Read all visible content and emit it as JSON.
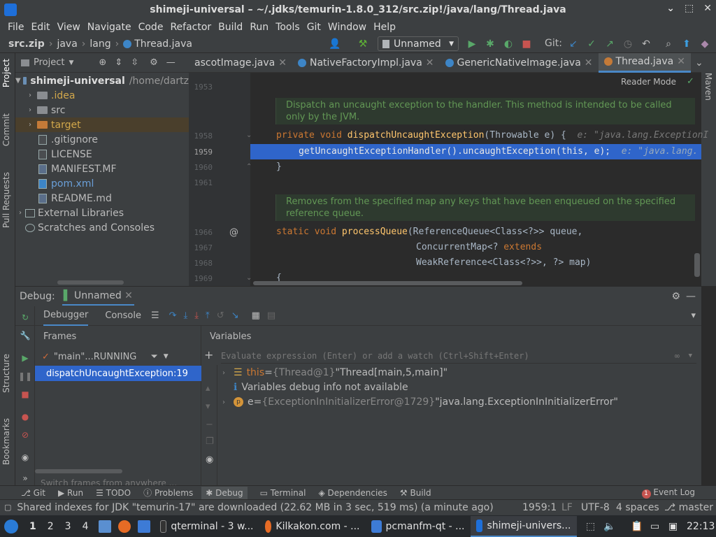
{
  "title": "shimeji-universal – ~/.jdks/temurin-1.8.0_312/src.zip!/java/lang/Thread.java",
  "menu": [
    "File",
    "Edit",
    "View",
    "Navigate",
    "Code",
    "Refactor",
    "Build",
    "Run",
    "Tools",
    "Git",
    "Window",
    "Help"
  ],
  "breadcrumbs": [
    "src.zip",
    "java",
    "lang",
    "Thread.java"
  ],
  "run_config": "Unnamed",
  "git_label": "Git:",
  "left_strip": [
    "Project",
    "Commit",
    "Pull Requests",
    "Structure",
    "Bookmarks"
  ],
  "right_strip": [
    "Maven"
  ],
  "project": {
    "header": "Project",
    "root_name": "shimeji-universal",
    "root_path": "/home/dartz",
    "items": [
      {
        "label": ".idea",
        "kind": "folder",
        "collapsed": true
      },
      {
        "label": "src",
        "kind": "folder",
        "collapsed": true
      },
      {
        "label": "target",
        "kind": "folder-excluded",
        "collapsed": true
      },
      {
        "label": ".gitignore",
        "kind": "file"
      },
      {
        "label": "LICENSE",
        "kind": "file"
      },
      {
        "label": "MANIFEST.MF",
        "kind": "file"
      },
      {
        "label": "pom.xml",
        "kind": "file"
      },
      {
        "label": "README.md",
        "kind": "file"
      }
    ],
    "external": "External Libraries",
    "scratches": "Scratches and Consoles"
  },
  "editor_tabs": [
    "ascotImage.java",
    "NativeFactoryImpl.java",
    "GenericNativeImage.java",
    "Thread.java"
  ],
  "reader_mode": "Reader Mode",
  "line_numbers": [
    "1953",
    "1958",
    "1959",
    "1960",
    "1961",
    "1966",
    "1967",
    "1968",
    "1969"
  ],
  "doc1": "Dispatch an uncaught exception to the handler. This method is intended to be called only by the JVM.",
  "doc2": "Removes from the specified map any keys that have been enqueued on the specified reference queue.",
  "code": {
    "l1958_kw": "private void ",
    "l1958_fn": "dispatchUncaughtException",
    "l1958_rest": "(Throwable e) {",
    "l1958_hint": "e: \"java.lang.ExceptionI",
    "l1959": "getUncaughtExceptionHandler().uncaughtException(this, e);",
    "l1959_hint": "e: \"java.lang.",
    "l1960": "}",
    "l1966_kw": "static void ",
    "l1966_fn": "processQueue",
    "l1966_rest": "(ReferenceQueue<Class<?>> queue,",
    "l1967_a": "ConcurrentMap<? ",
    "l1967_kw": "extends",
    "l1968": "WeakReference<Class<?>>, ?> map)",
    "l1969": "{",
    "annotation": "@"
  },
  "debug": {
    "label": "Debug:",
    "session": "Unnamed",
    "tab_debugger": "Debugger",
    "tab_console": "Console",
    "frames_header": "Frames",
    "variables_header": "Variables",
    "thread": "\"main\"...RUNNING",
    "frame": "dispatchUncaughtException:19",
    "eval_placeholder": "Evaluate expression (Enter) or add a watch (Ctrl+Shift+Enter)",
    "vars": [
      {
        "name": "this",
        "type": "{Thread@1}",
        "value": "\"Thread[main,5,main]\""
      },
      {
        "info": "Variables debug info not available"
      },
      {
        "name": "e",
        "type": "{ExceptionInInitializerError@1729}",
        "value": "\"java.lang.ExceptionInInitializerError\""
      }
    ],
    "switch_hint": "Switch frames from anywhere ..."
  },
  "toolwindows": [
    "Git",
    "Run",
    "TODO",
    "Problems",
    "Debug",
    "Terminal",
    "Dependencies",
    "Build"
  ],
  "event_log": "Event Log",
  "event_count": "1",
  "status": {
    "message": "Shared indexes for JDK \"temurin-17\" are downloaded (22.62 MB in 3 sec, 519 ms) (a minute ago)",
    "position": "1959:1",
    "line_sep": "LF",
    "encoding": "UTF-8",
    "indent": "4 spaces",
    "branch": "master"
  },
  "taskbar": {
    "workspaces": [
      "1",
      "2",
      "3",
      "4"
    ],
    "tasks": [
      "qterminal - 3 w...",
      "Kilkakon.com - ...",
      "pcmanfm-qt - ...",
      "shimeji-univers..."
    ],
    "clock": "22:13"
  },
  "colors": {
    "accent": "#2f65ca",
    "keyword": "#cc7832",
    "function": "#ffc66d",
    "doc": "#629755"
  }
}
